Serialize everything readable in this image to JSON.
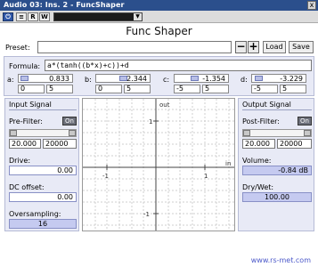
{
  "window": {
    "title": "Audio 03: Ins. 2 - FuncShaper",
    "close": "x"
  },
  "toolbar": {
    "power": "⏻",
    "list": "≡",
    "read": "R",
    "write": "W",
    "preset_arrow": "▼"
  },
  "header": {
    "title": "Func Shaper"
  },
  "preset": {
    "label": "Preset:",
    "value": "",
    "minus": "−",
    "plus": "+",
    "load": "Load",
    "save": "Save"
  },
  "formula": {
    "label": "Formula:",
    "value": "a*(tanh((b*x)+c))+d"
  },
  "params": [
    {
      "name": "a:",
      "value": "0.833",
      "min": "0",
      "max": "5",
      "position": 0.17
    },
    {
      "name": "b:",
      "value": "2.344",
      "min": "0",
      "max": "5",
      "position": 0.47
    },
    {
      "name": "c:",
      "value": "-1.354",
      "min": "-5",
      "max": "5",
      "position": 0.36
    },
    {
      "name": "d:",
      "value": "-3.229",
      "min": "-5",
      "max": "5",
      "position": 0.18
    }
  ],
  "input_signal": {
    "title": "Input Signal",
    "prefilter_label": "Pre-Filter:",
    "prefilter_state": "On",
    "filter_low": "20.000",
    "filter_high": "20000",
    "drive_label": "Drive:",
    "drive_value": "0.00",
    "drive_level": 0.0,
    "dc_label": "DC offset:",
    "dc_value": "0.00",
    "oversampling_label": "Oversampling:",
    "oversampling_value": "16"
  },
  "output_signal": {
    "title": "Output Signal",
    "postfilter_label": "Post-Filter:",
    "postfilter_state": "On",
    "filter_low": "20.000",
    "filter_high": "20000",
    "volume_label": "Volume:",
    "volume_value": "-0.84 dB",
    "volume_level": 0.95,
    "drywet_label": "Dry/Wet:",
    "drywet_value": "100.00",
    "drywet_level": 1.0
  },
  "graph": {
    "x_axis_label": "in",
    "y_axis_label": "out",
    "tick_left": "-1",
    "tick_right": "1",
    "tick_top": "1",
    "tick_bottom": "-1"
  },
  "footer": {
    "link": "www.rs-met.com"
  },
  "colors": {
    "titlebar": "#2b4f8c",
    "panel": "#e8eaf6",
    "value_bar": "#c5caf0",
    "link": "#4b58c9"
  }
}
